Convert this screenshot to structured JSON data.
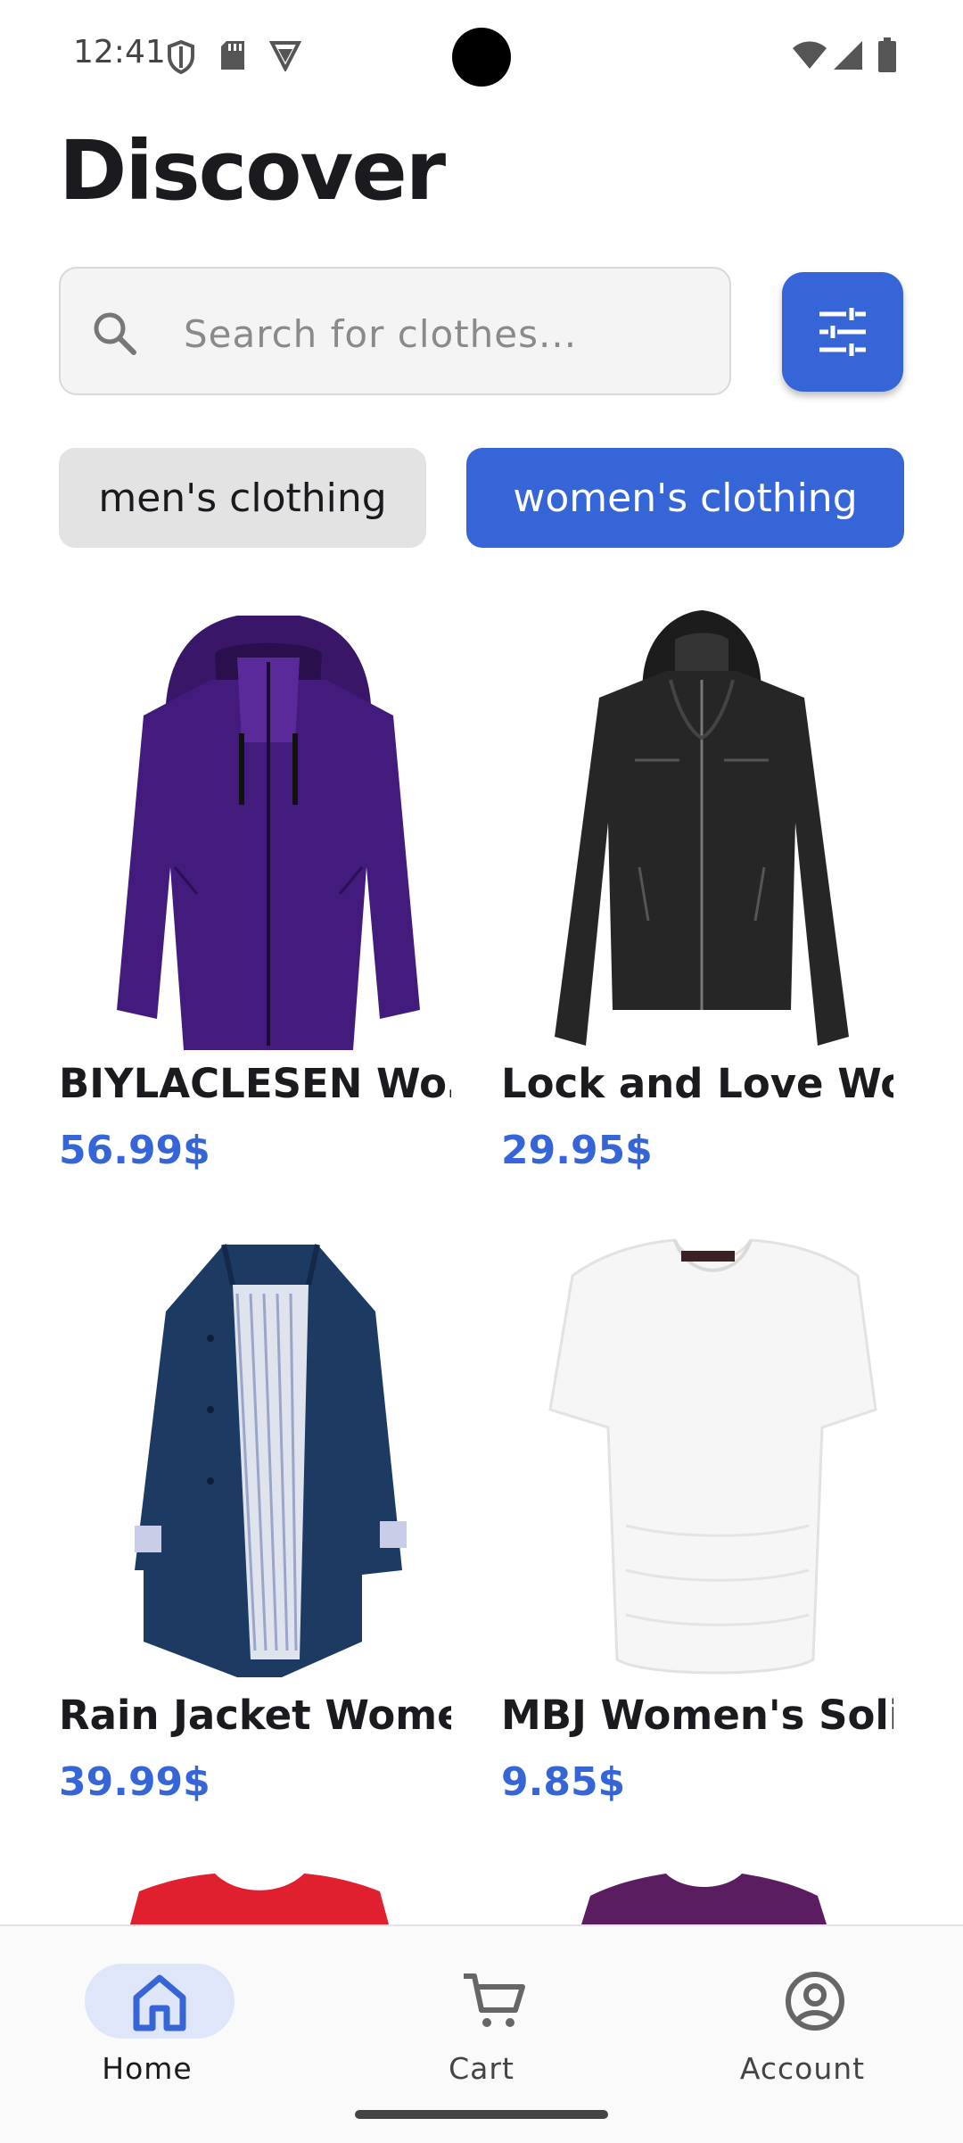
{
  "status_bar": {
    "time": "12:41",
    "left_icons": [
      "shield-icon",
      "sd-card-icon",
      "vpn-icon"
    ],
    "right_icons": [
      "wifi-icon",
      "cellular-signal-icon",
      "battery-icon"
    ]
  },
  "header": {
    "title": "Discover"
  },
  "search": {
    "placeholder": "Search for clothes...",
    "value": ""
  },
  "filter_button": {
    "icon": "tune-icon",
    "color": "#3565d6"
  },
  "categories": [
    {
      "label": "men's clothing",
      "selected": false
    },
    {
      "label": "women's clothing",
      "selected": true
    }
  ],
  "products": [
    {
      "name": "BIYLACLESEN Wo…",
      "price": "56.99$",
      "color": "#3f1970"
    },
    {
      "name": "Lock and Love Wo…",
      "price": "29.95$",
      "color": "#252525"
    },
    {
      "name": "Rain Jacket Wome…",
      "price": "39.99$",
      "color": "#1d3a63"
    },
    {
      "name": "MBJ Women's Soli…",
      "price": "9.85$",
      "color": "#f4f4f4"
    }
  ],
  "bottom_nav": [
    {
      "label": "Home",
      "icon": "home-icon",
      "active": true
    },
    {
      "label": "Cart",
      "icon": "cart-icon",
      "active": false
    },
    {
      "label": "Account",
      "icon": "account-icon",
      "active": false
    }
  ],
  "colors": {
    "accent": "#3565d6",
    "chip_inactive": "#e3e3e3",
    "nav_active_pill": "#dfe6fa"
  }
}
